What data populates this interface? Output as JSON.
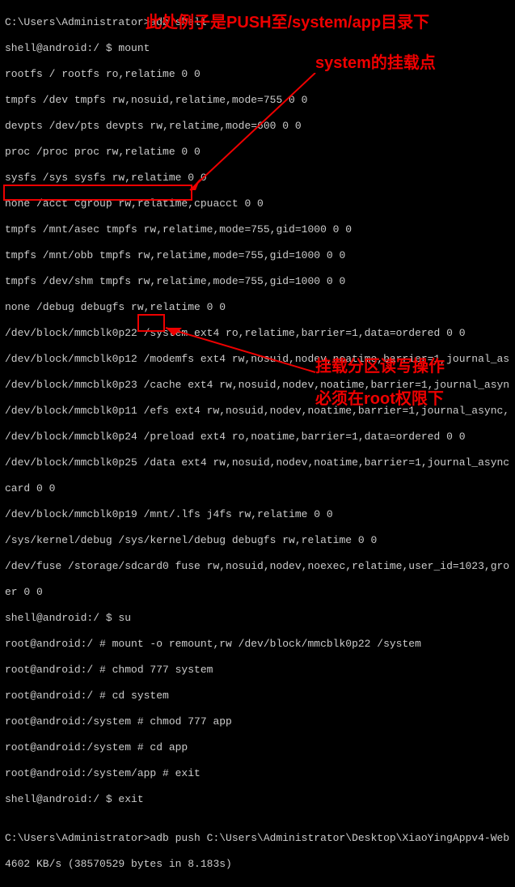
{
  "annotations": {
    "a1": "此处例子是PUSH至/system/app目录下",
    "a2": "system的挂载点",
    "a3": "挂载分区读写操作",
    "a4": "必须在root权限下"
  },
  "lines": {
    "l0": "C:\\Users\\Administrator>adb shell",
    "l1": "shell@android:/ $ mount",
    "l2": "rootfs / rootfs ro,relatime 0 0",
    "l3": "tmpfs /dev tmpfs rw,nosuid,relatime,mode=755 0 0",
    "l4": "devpts /dev/pts devpts rw,relatime,mode=600 0 0",
    "l5": "proc /proc proc rw,relatime 0 0",
    "l6": "sysfs /sys sysfs rw,relatime 0 0",
    "l7": "none /acct cgroup rw,relatime,cpuacct 0 0",
    "l8": "tmpfs /mnt/asec tmpfs rw,relatime,mode=755,gid=1000 0 0",
    "l9": "tmpfs /mnt/obb tmpfs rw,relatime,mode=755,gid=1000 0 0",
    "l10": "tmpfs /dev/shm tmpfs rw,relatime,mode=755,gid=1000 0 0",
    "l11": "none /debug debugfs rw,relatime 0 0",
    "l12": "/dev/block/mmcblk0p22 /system ext4 ro,relatime,barrier=1,data=ordered 0 0",
    "l13": "/dev/block/mmcblk0p12 /modemfs ext4 rw,nosuid,nodev,noatime,barrier=1,journal_as",
    "l14": "/dev/block/mmcblk0p23 /cache ext4 rw,nosuid,nodev,noatime,barrier=1,journal_asyn",
    "l15": "/dev/block/mmcblk0p11 /efs ext4 rw,nosuid,nodev,noatime,barrier=1,journal_async,",
    "l16": "/dev/block/mmcblk0p24 /preload ext4 ro,noatime,barrier=1,data=ordered 0 0",
    "l17": "/dev/block/mmcblk0p25 /data ext4 rw,nosuid,nodev,noatime,barrier=1,journal_async",
    "l18": "card 0 0",
    "l19": "/dev/block/mmcblk0p19 /mnt/.lfs j4fs rw,relatime 0 0",
    "l20": "/sys/kernel/debug /sys/kernel/debug debugfs rw,relatime 0 0",
    "l21": "/dev/fuse /storage/sdcard0 fuse rw,nosuid,nodev,noexec,relatime,user_id=1023,gro",
    "l22": "er 0 0",
    "l23": "shell@android:/ $ su",
    "l24": "root@android:/ # mount -o remount,rw /dev/block/mmcblk0p22 /system",
    "l25": "root@android:/ # chmod 777 system",
    "l26": "root@android:/ # cd system",
    "l27": "root@android:/system # chmod 777 app",
    "l28": "root@android:/system # cd app",
    "l29": "root@android:/system/app # exit",
    "l30": "shell@android:/ $ exit",
    "l31": "",
    "l32": "C:\\Users\\Administrator>adb push C:\\Users\\Administrator\\Desktop\\XiaoYingAppv4-Web",
    "l33": "4602 KB/s (38570529 bytes in 8.183s)"
  }
}
